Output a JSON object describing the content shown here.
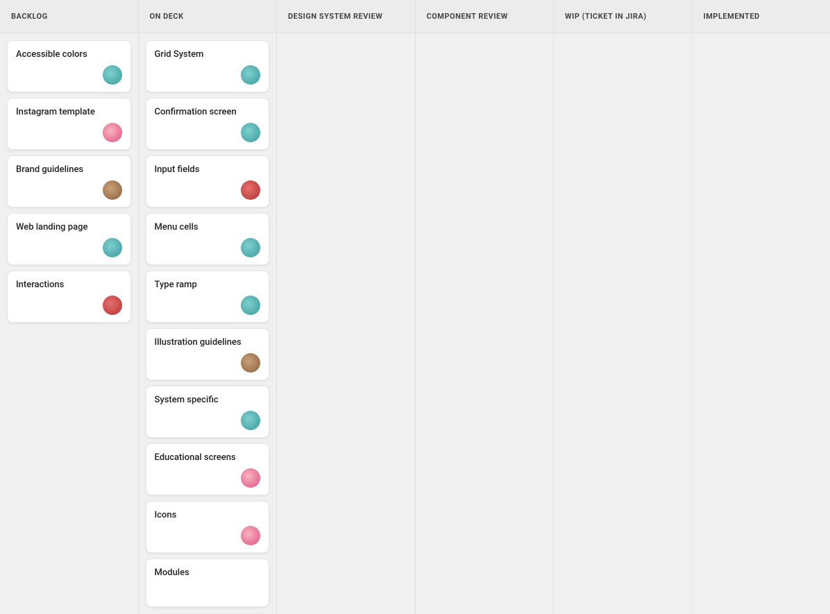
{
  "columns": [
    {
      "id": "backlog",
      "label": "BACKLOG",
      "cards": [
        {
          "id": "accessible-colors",
          "title": "Accessible colors",
          "avatar": "teal"
        },
        {
          "id": "instagram-template",
          "title": "Instagram template",
          "avatar": "pink"
        },
        {
          "id": "brand-guidelines",
          "title": "Brand guidelines",
          "avatar": "brown"
        },
        {
          "id": "web-landing-page",
          "title": "Web landing page",
          "avatar": "teal"
        },
        {
          "id": "interactions",
          "title": "Interactions",
          "avatar": "red"
        }
      ]
    },
    {
      "id": "on-deck",
      "label": "ON DECK",
      "cards": [
        {
          "id": "grid-system",
          "title": "Grid System",
          "avatar": "teal"
        },
        {
          "id": "confirmation-screen",
          "title": "Confirmation screen",
          "avatar": "teal"
        },
        {
          "id": "input-fields",
          "title": "Input fields",
          "avatar": "red"
        },
        {
          "id": "menu-cells",
          "title": "Menu cells",
          "avatar": "teal"
        },
        {
          "id": "type-ramp",
          "title": "Type ramp",
          "avatar": "teal"
        },
        {
          "id": "illustration-guidelines",
          "title": "Illustration guidelines",
          "avatar": "brown"
        },
        {
          "id": "system-specific",
          "title": "System specific",
          "avatar": "teal"
        },
        {
          "id": "educational-screens",
          "title": "Educational screens",
          "avatar": "pink"
        },
        {
          "id": "icons",
          "title": "Icons",
          "avatar": "pink"
        },
        {
          "id": "modules",
          "title": "Modules",
          "avatar": ""
        }
      ]
    },
    {
      "id": "design-system-review",
      "label": "DESIGN SYSTEM REVIEW",
      "cards": []
    },
    {
      "id": "component-review",
      "label": "COMPONENT REVIEW",
      "cards": []
    },
    {
      "id": "wip-ticket-jira",
      "label": "WIP (TICKET IN JIRA)",
      "cards": []
    },
    {
      "id": "implemented",
      "label": "IMPLEMENTED",
      "cards": []
    }
  ]
}
